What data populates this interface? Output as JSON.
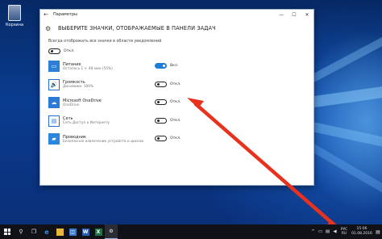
{
  "desktop": {
    "recycle_bin_label": "Корзина"
  },
  "window": {
    "app_title": "Параметры",
    "page_title": "ВЫБЕРИТЕ ЗНАЧКИ, ОТОБРАЖАЕМЫЕ В ПАНЕЛИ ЗАДАЧ",
    "always_show_label": "Всегда отображать все значки в области уведомлений",
    "always_show_state": "Откл.",
    "items": [
      {
        "name": "Питание",
        "desc": "Осталось 1 ч. 48 мин (55%)",
        "state": "Вкл.",
        "on": true,
        "icon": "battery-icon"
      },
      {
        "name": "Громкость",
        "desc": "Динамики: 100%",
        "state": "Откл.",
        "on": false,
        "icon": "volume-icon"
      },
      {
        "name": "Microsoft OneDrive",
        "desc": "OneDrive",
        "state": "Откл.",
        "on": false,
        "icon": "onedrive-icon"
      },
      {
        "name": "Сеть",
        "desc": "Сеть Доступ к Интернету",
        "state": "Откл.",
        "on": false,
        "icon": "network-icon"
      },
      {
        "name": "Проводник",
        "desc": "Безопасное извлечение устройств и дисков",
        "state": "Откл.",
        "on": false,
        "icon": "explorer-icon"
      }
    ]
  },
  "taskbar": {
    "language_top": "РУС",
    "language_bottom": "RU",
    "time": "15:06",
    "date": "01.08.2016"
  },
  "colors": {
    "toggle_on": "#1e7bd7",
    "arrow": "#e8321e"
  }
}
